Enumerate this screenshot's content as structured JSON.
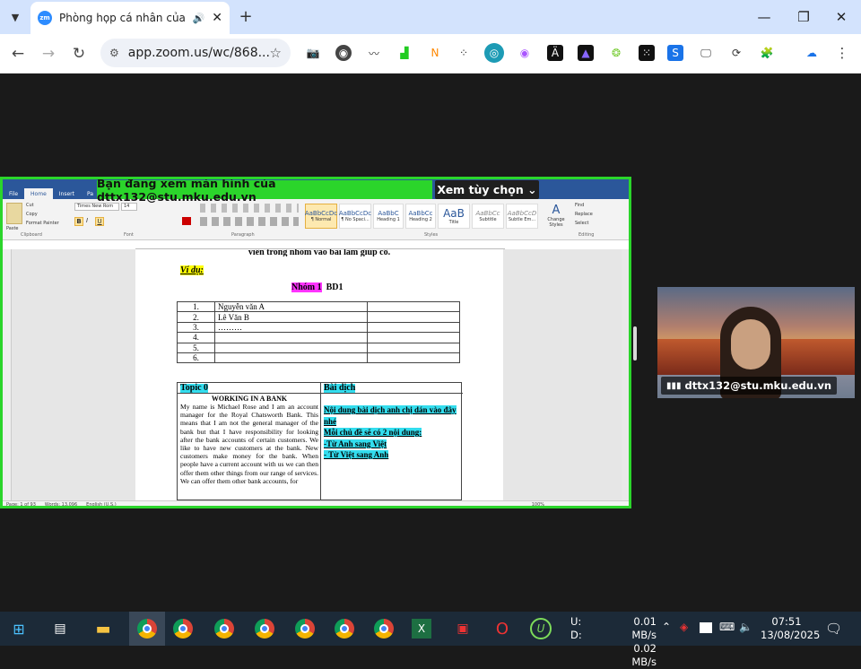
{
  "browser": {
    "tab_title": "Phòng họp cá nhân của dttx",
    "tab_favicon_text": "zm",
    "url": "app.zoom.us/wc/868..."
  },
  "banner": {
    "viewing_text": "Bạn đang xem màn hình của  dttx132@stu.mku.edu.vn",
    "options_label": "Xem tùy chọn"
  },
  "word": {
    "tabs": [
      "File",
      "Home",
      "Insert",
      "Pa"
    ],
    "font_name": "Times New Rom",
    "font_size": "14",
    "styles": [
      {
        "sample": "AaBbCcDc",
        "name": "¶ Normal"
      },
      {
        "sample": "AaBbCcDc",
        "name": "¶ No Spaci..."
      },
      {
        "sample": "AaBbC",
        "name": "Heading 1"
      },
      {
        "sample": "AaBbCc",
        "name": "Heading 2"
      },
      {
        "sample": "AaB",
        "name": "Title"
      },
      {
        "sample": "AaBbCc",
        "name": "Subtitle"
      },
      {
        "sample": "AaBbCcD",
        "name": "Subtle Em..."
      }
    ],
    "groups": [
      "Clipboard",
      "Font",
      "Paragraph",
      "Styles",
      "Editing"
    ],
    "clipboard": {
      "paste": "Paste",
      "cut": "Cut",
      "copy": "Copy",
      "format_painter": "Format Painter"
    },
    "editing": {
      "find": "Find",
      "replace": "Replace",
      "select": "Select"
    },
    "change_styles": "Change Styles",
    "status": {
      "page": "Page: 1 of 93",
      "words": "Words: 13,096",
      "lang": "English (U.S.)",
      "zoom": "100%"
    },
    "doc": {
      "top_line": "viên trong nhóm vào bài làm giúp cô.",
      "example_label": "Ví dụ:",
      "group_label": "Nhóm 1",
      "group_class": "BD1",
      "members": [
        {
          "no": "1.",
          "name": "Nguyễn văn A"
        },
        {
          "no": "2.",
          "name": "Lê Văn B"
        },
        {
          "no": "3.",
          "name": "………"
        },
        {
          "no": "4.",
          "name": ""
        },
        {
          "no": "5.",
          "name": ""
        },
        {
          "no": "6.",
          "name": ""
        }
      ],
      "topic_header": "Topic  0",
      "translation_header": "Bài dịch",
      "article_title": "WORKING IN A BANK",
      "article_text": "My name is Michael Rose and I am an account manager for the Royal Chatsworth Bank. This means that I am not the general manager of the bank but that I have responsibility for looking after the bank accounts of certain customers. We like to have new customers at the bank. New customers make money for the bank. When people have a current account with us we can then offer them other things from our range of services. We can offer them other bank accounts, for",
      "instructions": [
        "Nội dung bài dịch anh chị dán vào đây nhé",
        "Mỗi chủ đề sẽ có 2 nội dung:",
        "-Từ Anh sang Việt",
        "- Từ Việt sang Anh"
      ]
    }
  },
  "participant": {
    "name": "dttx132@stu.mku.edu.vn"
  },
  "taskbar": {
    "net_labels": [
      "U:",
      "D:"
    ],
    "net_values": [
      "0.01 MB/s",
      "0.02 MB/s"
    ],
    "time": "07:51",
    "date": "13/08/2025"
  }
}
